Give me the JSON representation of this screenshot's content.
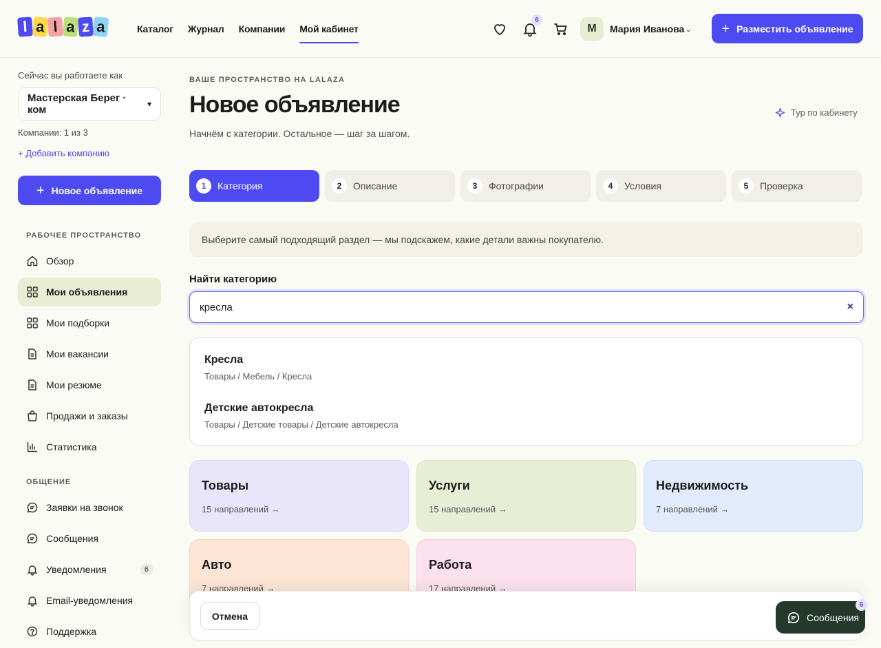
{
  "brand": {
    "logo_letters": [
      "l",
      "a",
      "l",
      "a",
      "z",
      "a"
    ],
    "logo_colors": [
      "#4e4af2",
      "#ffd84d",
      "#f08a8a",
      "#b9e07a",
      "#4e4af2",
      "#8fd3f2"
    ]
  },
  "nav": {
    "items": [
      {
        "label": "Каталог"
      },
      {
        "label": "Журнал"
      },
      {
        "label": "Компании"
      },
      {
        "label": "Мой кабинет",
        "active": true
      }
    ]
  },
  "header": {
    "favorites_icon": "heart-icon",
    "bell_icon": "bell-icon",
    "notifications_count": "6",
    "cart_icon": "cart-icon",
    "user_initial": "М",
    "user_name": "Мария Иванова",
    "post_button": "Разместить объявление"
  },
  "sidebar": {
    "working_as_label": "Сейчас вы работаете как",
    "company_selected": "Мастерская Берег · ком",
    "companies_count": "Компании: 1 из 3",
    "add_company": "+ Добавить компанию",
    "new_ad_button": "Новое объявление",
    "section_workspace": "РАБОЧЕЕ ПРОСТРАНСТВО",
    "workspace_items": [
      {
        "label": "Обзор",
        "icon": "home-icon"
      },
      {
        "label": "Мои объявления",
        "icon": "grid-icon",
        "active": true
      },
      {
        "label": "Мои подборки",
        "icon": "grid-icon"
      },
      {
        "label": "Мои вакансии",
        "icon": "document-icon"
      },
      {
        "label": "Мои резюме",
        "icon": "document-icon"
      },
      {
        "label": "Продажи и заказы",
        "icon": "bag-icon"
      },
      {
        "label": "Статистика",
        "icon": "chart-icon"
      }
    ],
    "section_communication": "ОБЩЕНИЕ",
    "communication_items": [
      {
        "label": "Заявки на звонок",
        "icon": "chat-icon"
      },
      {
        "label": "Сообщения",
        "icon": "chat-icon"
      },
      {
        "label": "Уведомления",
        "icon": "bell-icon",
        "count": "6"
      },
      {
        "label": "Email-уведомления",
        "icon": "bell-icon"
      },
      {
        "label": "Поддержка",
        "icon": "help-icon"
      }
    ]
  },
  "main": {
    "eyebrow": "ВАШЕ ПРОСТРАНСТВО НА LALAZA",
    "title": "Новое объявление",
    "subtitle": "Начнём с категории. Остальное — шаг за шагом.",
    "tour_link": "Тур по кабинету",
    "steps": [
      {
        "num": "1",
        "label": "Категория",
        "active": true
      },
      {
        "num": "2",
        "label": "Описание"
      },
      {
        "num": "3",
        "label": "Фотографии"
      },
      {
        "num": "4",
        "label": "Условия"
      },
      {
        "num": "5",
        "label": "Проверка"
      }
    ],
    "hint": "Выберите самый подходящий раздел — мы подскажем, какие детали важны покупателю.",
    "search_label": "Найти категорию",
    "search_value": "кресла",
    "search_clear": "×",
    "results": [
      {
        "title": "Кресла",
        "path": "Товары / Мебель / Кресла"
      },
      {
        "title": "Детские автокресла",
        "path": "Товары / Детские товары / Детские автокресла"
      }
    ],
    "categories": [
      {
        "title": "Товары",
        "sub": "15 направлений →",
        "color": "#e9e6fb"
      },
      {
        "title": "Услуги",
        "sub": "15 направлений →",
        "color": "#e8eed5"
      },
      {
        "title": "Недвижимость",
        "sub": "7 направлений →",
        "color": "#e2ebfb"
      },
      {
        "title": "Авто",
        "sub": "7 направлений →",
        "color": "#fde5d6"
      },
      {
        "title": "Работа",
        "sub": "17 направлений →",
        "color": "#fbe1ec"
      }
    ],
    "cancel_button": "Отмена"
  },
  "messages_fab": {
    "label": "Сообщения",
    "count": "6"
  },
  "colors": {
    "accent": "#4e4af2",
    "active_nav_bg": "#e8edd4",
    "fab_bg": "#24382c"
  }
}
